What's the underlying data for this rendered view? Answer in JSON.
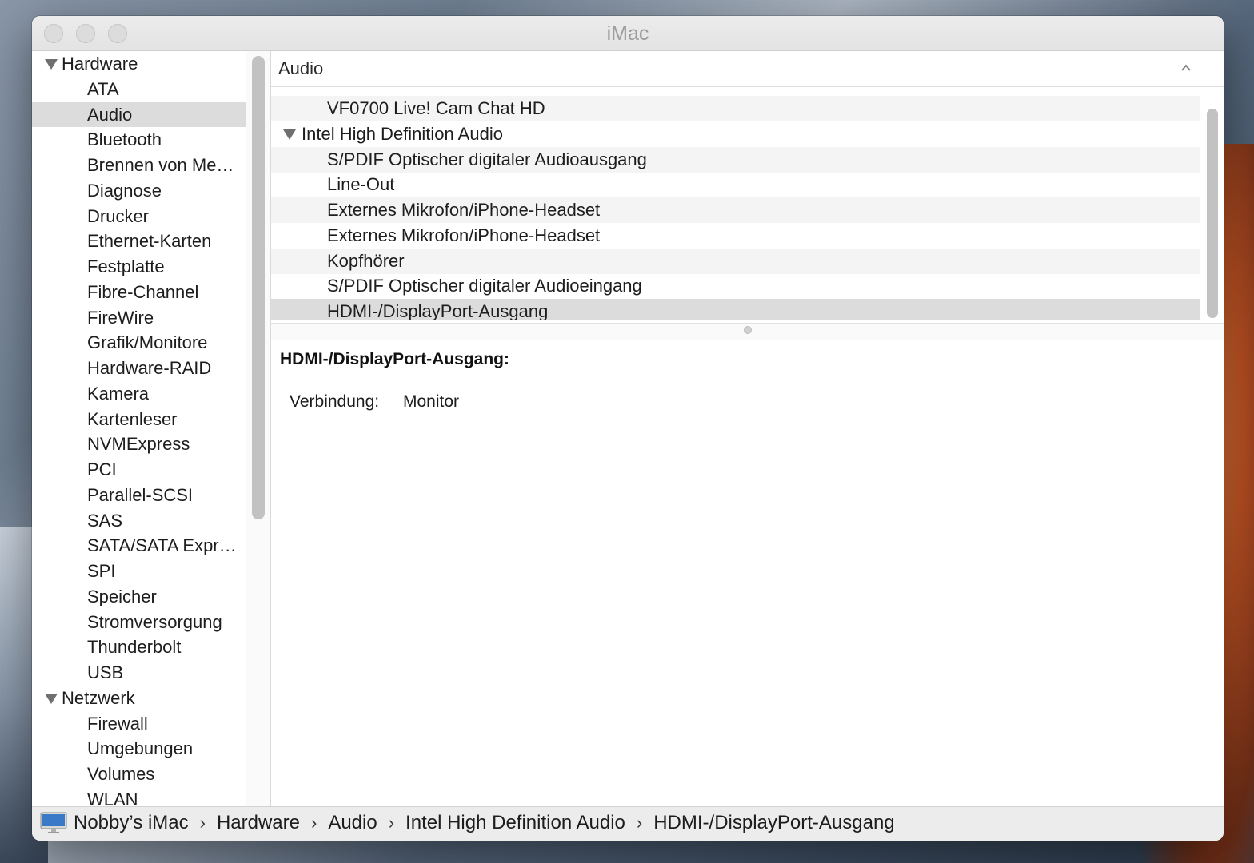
{
  "window": {
    "title": "iMac"
  },
  "sidebar": {
    "groups": [
      {
        "label": "Hardware",
        "items": [
          "ATA",
          "Audio",
          "Bluetooth",
          "Brennen von Me…",
          "Diagnose",
          "Drucker",
          "Ethernet-Karten",
          "Festplatte",
          "Fibre-Channel",
          "FireWire",
          "Grafik/Monitore",
          "Hardware-RAID",
          "Kamera",
          "Kartenleser",
          "NVMExpress",
          "PCI",
          "Parallel-SCSI",
          "SAS",
          "SATA/SATA Expr…",
          "SPI",
          "Speicher",
          "Stromversorgung",
          "Thunderbolt",
          "USB"
        ]
      },
      {
        "label": "Netzwerk",
        "items": [
          "Firewall",
          "Umgebungen",
          "Volumes",
          "WLAN"
        ]
      }
    ],
    "selected": "Audio"
  },
  "content": {
    "column_header": "Audio",
    "rows": [
      {
        "label": "VF0700 Live! Cam Chat HD",
        "kind": "leaf"
      },
      {
        "label": "Intel High Definition Audio",
        "kind": "parent"
      },
      {
        "label": "S/PDIF Optischer digitaler Audioausgang",
        "kind": "leaf"
      },
      {
        "label": "Line-Out",
        "kind": "leaf"
      },
      {
        "label": "Externes Mikrofon/iPhone-Headset",
        "kind": "leaf"
      },
      {
        "label": "Externes Mikrofon/iPhone-Headset",
        "kind": "leaf"
      },
      {
        "label": "Kopfhörer",
        "kind": "leaf"
      },
      {
        "label": "S/PDIF Optischer digitaler Audioeingang",
        "kind": "leaf"
      },
      {
        "label": "HDMI-/DisplayPort-Ausgang",
        "kind": "leaf"
      }
    ],
    "selected_row": "HDMI-/DisplayPort-Ausgang",
    "detail": {
      "title": "HDMI-/DisplayPort-Ausgang:",
      "label": "Verbindung:",
      "value": "Monitor"
    }
  },
  "breadcrumb": {
    "icon": "imac-icon",
    "items": [
      "Nobby’s iMac",
      "Hardware",
      "Audio",
      "Intel High Definition Audio",
      "HDMI-/DisplayPort-Ausgang"
    ],
    "separator": "›"
  }
}
